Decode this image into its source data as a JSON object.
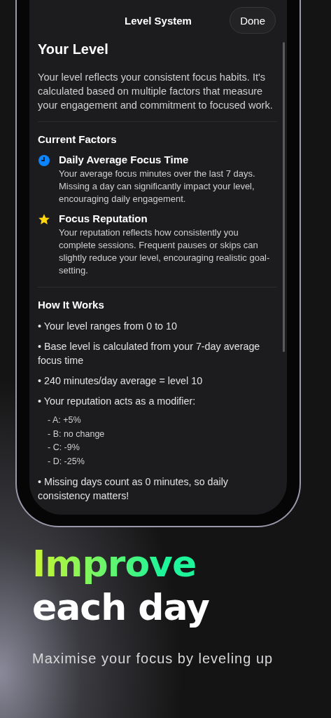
{
  "sheet": {
    "title": "Level System",
    "done_button": "Done",
    "heading": "Your Level",
    "intro": "Your level reflects your consistent focus habits. It's calculated based on multiple factors that measure your engagement and commitment to focused work.",
    "factors_heading": "Current Factors",
    "factors": [
      {
        "kind": "clock",
        "title": "Daily Average Focus Time",
        "description": "Your average focus minutes over the last 7 days. Missing a day can significantly impact your level, encouraging daily engagement."
      },
      {
        "kind": "star",
        "title": "Focus Reputation",
        "description": "Your reputation reflects how consistently you complete sessions. Frequent pauses or skips can slightly reduce your level, encouraging realistic goal-setting."
      }
    ],
    "how_heading": "How It Works",
    "rules": [
      {
        "text": "• Your level ranges from 0 to 10"
      },
      {
        "text": "• Base level is calculated from your 7-day average focus time"
      },
      {
        "text": "• 240 minutes/day average = level 10"
      },
      {
        "text": "• Your reputation acts as a modifier:",
        "children": [
          "- A: +5%",
          "- B: no change",
          "- C: -9%",
          "- D: -25%"
        ]
      },
      {
        "text": "• Missing days count as 0 minutes, so daily consistency matters!"
      }
    ]
  },
  "promo": {
    "headline_1": "Improve",
    "headline_2": "each day",
    "subtitle": "Maximise your focus by leveling up"
  }
}
